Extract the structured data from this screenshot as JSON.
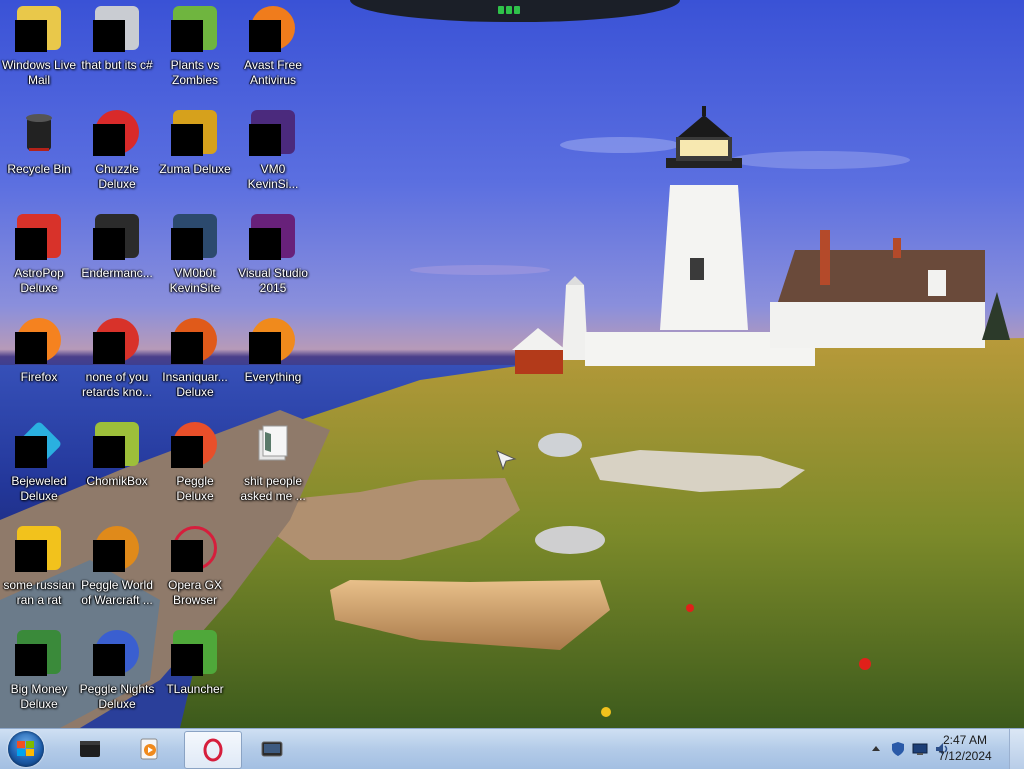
{
  "desktop": {
    "icons": [
      {
        "label": "Windows Live Mail",
        "color": "#e9c84a"
      },
      {
        "label": "that but its c#",
        "color": "#c9ccd2"
      },
      {
        "label": "Plants vs Zombies",
        "color": "#6fb53f"
      },
      {
        "label": "Avast Free Antivirus",
        "color": "#f07c1c"
      },
      {
        "label": "Recycle Bin",
        "color": "#222222"
      },
      {
        "label": "Chuzzle Deluxe",
        "color": "#d92a2a"
      },
      {
        "label": "Zuma Deluxe",
        "color": "#d6a11c"
      },
      {
        "label": "VM0 KevinSi...",
        "color": "#4b2a7d"
      },
      {
        "label": "AstroPop Deluxe",
        "color": "#d8322a"
      },
      {
        "label": "Endermanc...",
        "color": "#2b2b2b"
      },
      {
        "label": "VM0b0t KevinSite",
        "color": "#2c4a6e"
      },
      {
        "label": "Visual Studio 2015",
        "color": "#68217a"
      },
      {
        "label": "Firefox",
        "color": "#f5821f"
      },
      {
        "label": "none of you retards kno...",
        "color": "#d8322a"
      },
      {
        "label": "Insaniquar... Deluxe",
        "color": "#e05a1a"
      },
      {
        "label": "Everything",
        "color": "#f08a1c"
      },
      {
        "label": "Bejeweled Deluxe",
        "color": "#2ab0e0"
      },
      {
        "label": "ChomikBox",
        "color": "#9dbf3a"
      },
      {
        "label": "Peggle Deluxe",
        "color": "#e84f2a"
      },
      {
        "label": "shit people asked me ...",
        "color": "#e6e6e6"
      },
      {
        "label": "some russian ran a rat",
        "color": "#f2c21c"
      },
      {
        "label": "Peggle World of Warcraft ...",
        "color": "#e08a1a"
      },
      {
        "label": "Opera GX Browser",
        "color": "#d61e3c"
      },
      {
        "label": "Big Money Deluxe",
        "color": "#3a8a3a"
      },
      {
        "label": "Peggle Nights Deluxe",
        "color": "#3a5fd0"
      },
      {
        "label": "TLauncher",
        "color": "#4fa83a"
      }
    ]
  },
  "taskbar": {
    "start_icon": "windows-flag-icon",
    "buttons": [
      {
        "icon": "terminal-icon",
        "active": false
      },
      {
        "icon": "media-player-icon",
        "active": false
      },
      {
        "icon": "opera-gx-icon",
        "active": true
      },
      {
        "icon": "window-switcher-icon",
        "active": false
      }
    ],
    "tray": {
      "icons": [
        "show-hidden-icons-chevron-icon",
        "defender-shield-icon",
        "network-monitor-icon",
        "volume-icon"
      ],
      "time": "2:47 AM",
      "date": "7/12/2024"
    }
  },
  "colors": {
    "taskbar": "#b3cbe8",
    "sky": "#3a52d6",
    "sea": "#23379a",
    "grass": "#8a8a2a"
  }
}
